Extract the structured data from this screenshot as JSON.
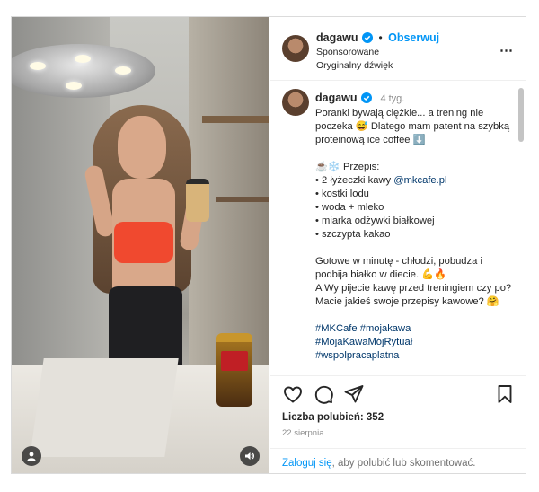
{
  "post": {
    "username": "dagawu",
    "follow_label": "Obserwuj",
    "separator": "•",
    "sponsored_label": "Sponsorowane",
    "audio_label": "Oryginalny dźwięk",
    "more_icon": "⋯",
    "time_ago": "4 tyg."
  },
  "caption": {
    "line1": "Poranki bywają ciężkie... a trening nie poczeka 😅 Dlatego mam patent na szybką proteinową ice coffee ⬇️",
    "recipe_title": "☕❄️ Przepis:",
    "ingredients": [
      "• 2 łyżeczki kawy ",
      "• kostki lodu",
      "• woda + mleko",
      "• miarka odżywki białkowej",
      "• szczypta kakao"
    ],
    "mention": "@mkcafe.pl",
    "para2": "Gotowe w minutę - chłodzi, pobudza i podbija białko w diecie. 💪🔥",
    "para3": "A Wy pijecie kawę przed treningiem czy po? Macie jakieś swoje przepisy kawowe? 🤗",
    "hashtags1": "#MKCafe #mojakawa",
    "hashtags2": "#MojaKawaMójRytuał",
    "hashtags3": "#wspolpracaplatna"
  },
  "stats": {
    "likes_label": "Liczba polubień: 352",
    "date": "22 sierpnia"
  },
  "footer": {
    "login_link": "Zaloguj się",
    "login_rest": ", aby polubić lub skomentować."
  },
  "colors": {
    "accent": "#0095f6",
    "text": "#262626",
    "muted": "#8e8e8e",
    "border": "#dbdbdb"
  },
  "icons": [
    "verified-badge-icon",
    "more-options-icon",
    "heart-icon",
    "comment-icon",
    "share-icon",
    "bookmark-icon",
    "user-tags-icon",
    "audio-icon"
  ]
}
